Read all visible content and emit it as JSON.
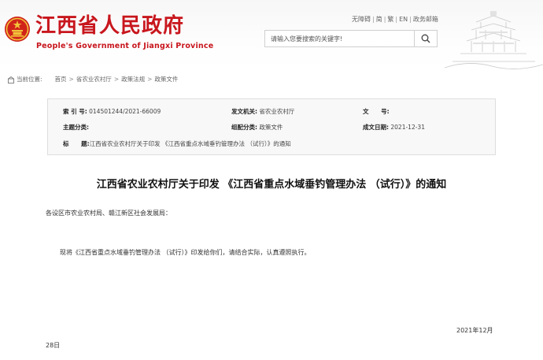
{
  "header": {
    "site_title": "江西省人民政府",
    "site_subtitle": "People's Government of Jiangxi Province",
    "top_links": [
      "无障碍",
      "简",
      "繁",
      "EN",
      "政务邮箱"
    ],
    "search_placeholder": "请输入您要搜索的关键字!",
    "brand_color": "#c8161d"
  },
  "breadcrumb": {
    "label": "当前位置:",
    "items": [
      "首页",
      "省农业农村厅",
      "政策法规",
      "政策文件"
    ],
    "separator": ">"
  },
  "meta": {
    "index_label": "索 引 号:",
    "index_value": "014501244/2021-66009",
    "issuer_label": "发文机关:",
    "issuer_value": "省农业农村厅",
    "docno_label": "文      号:",
    "docno_value": "",
    "topic_label": "主题分类:",
    "topic_value": "",
    "category_label": "组配分类:",
    "category_value": "政策文件",
    "date_label": "成文日期:",
    "date_value": "2021-12-31",
    "title_label": "标      题:",
    "title_value": "江西省农业农村厅关于印发 《江西省重点水域垂钓管理办法 （试行）》的通知"
  },
  "document": {
    "title": "江西省农业农村厅关于印发 《江西省重点水域垂钓管理办法 （试行）》的通知",
    "recipients": "各设区市农业农村局、赣江新区社会发展局：",
    "body": "现将《江西省重点水域垂钓管理办法 （试行）》印发给你们，请结合实际，认真遵照执行。",
    "date_part1": "2021年12月",
    "date_part2": "28日"
  },
  "icons": [
    "emblem-icon",
    "search-icon",
    "location-icon",
    "pavilion-illustration"
  ]
}
